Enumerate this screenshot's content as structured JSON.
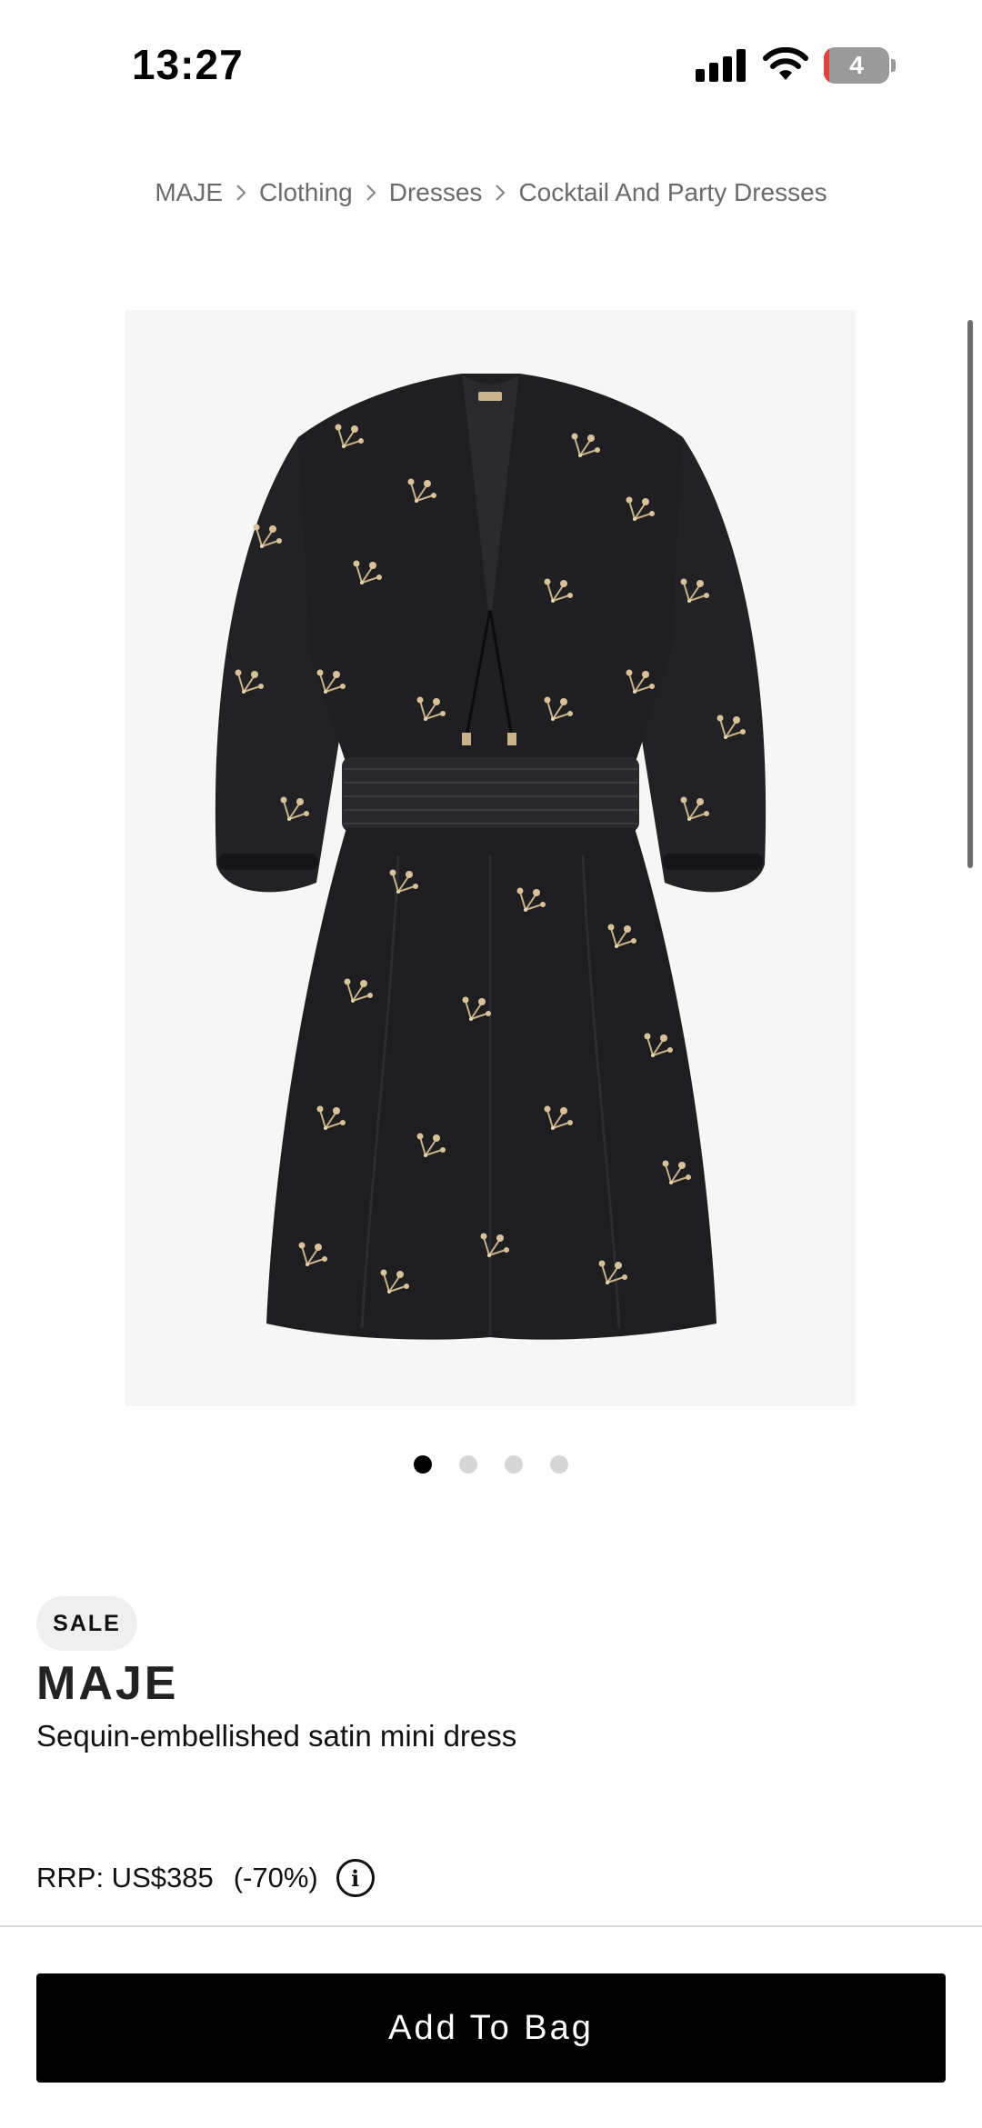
{
  "status_bar": {
    "time": "13:27",
    "battery_level": "4",
    "icons": [
      "signal-icon",
      "wifi-icon",
      "battery-icon"
    ]
  },
  "breadcrumb": [
    "MAJE",
    "Clothing",
    "Dresses",
    "Cocktail And Party Dresses"
  ],
  "carousel": {
    "count": 4,
    "active_index": 0
  },
  "product": {
    "badge": "SALE",
    "brand": "MAJE",
    "name": "Sequin-embellished satin mini dress",
    "rrp": "RRP: US$385",
    "discount": "(-70%)",
    "info_icon": "i"
  },
  "cta": {
    "add_to_bag": "Add To Bag"
  },
  "colors": {
    "dress": "#1e1e20",
    "dress_pattern": "#c9b28a",
    "image_bg": "#f6f6f6",
    "button_bg": "#000000",
    "battery_low": "#e0443e"
  }
}
